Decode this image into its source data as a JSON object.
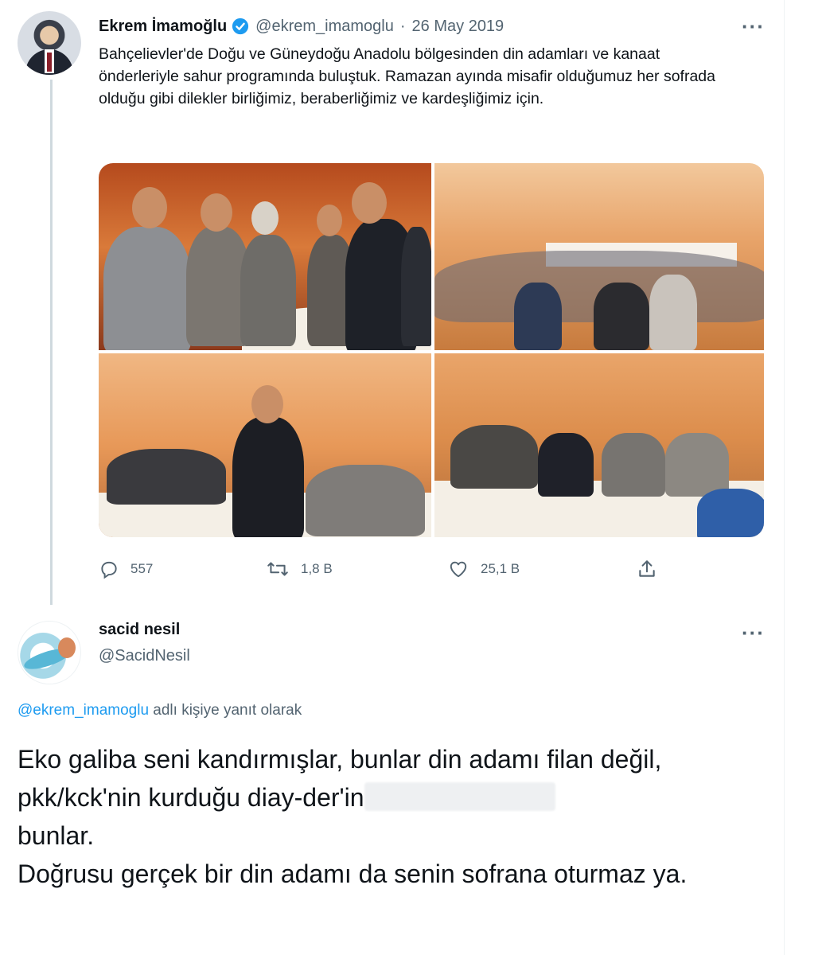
{
  "tweet1": {
    "name": "Ekrem İmamoğlu",
    "handle": "@ekrem_imamoglu",
    "separator": "·",
    "date": "26 May 2019",
    "more": "···",
    "text": "Bahçelievler'de Doğu ve Güneydoğu Anadolu bölgesinden din adamları ve kanaat önderleriyle sahur programında buluştuk. Ramazan ayında misafir olduğumuz her sofrada olduğu gibi dilekler birliğimiz, beraberliğimiz ve kardeşliğimiz için.",
    "stats": {
      "replies": "557",
      "retweets": "1,8 B",
      "likes": "25,1 B"
    }
  },
  "tweet2": {
    "name": "sacid nesil",
    "handle": "@SacidNesil",
    "more": "···",
    "reply_mention": "@ekrem_imamoglu",
    "reply_suffix": " adlı kişiye yanıt olarak",
    "text_part1": "Eko galiba seni kandırmışlar, bunlar din adamı filan değil, pkk/kck'nin kurduğu diay-der'in",
    "text_part2": " bunlar.",
    "text_part3": "Doğrusu gerçek bir din adamı da senin sofrana oturmaz ya."
  },
  "colors": {
    "accent": "#1d9bf0",
    "secondary_text": "#536471",
    "verified": "#1d9bf0"
  },
  "icons": {
    "verified": "verified-badge-icon",
    "reply": "reply-icon",
    "retweet": "retweet-icon",
    "like": "heart-icon",
    "share": "share-icon"
  }
}
